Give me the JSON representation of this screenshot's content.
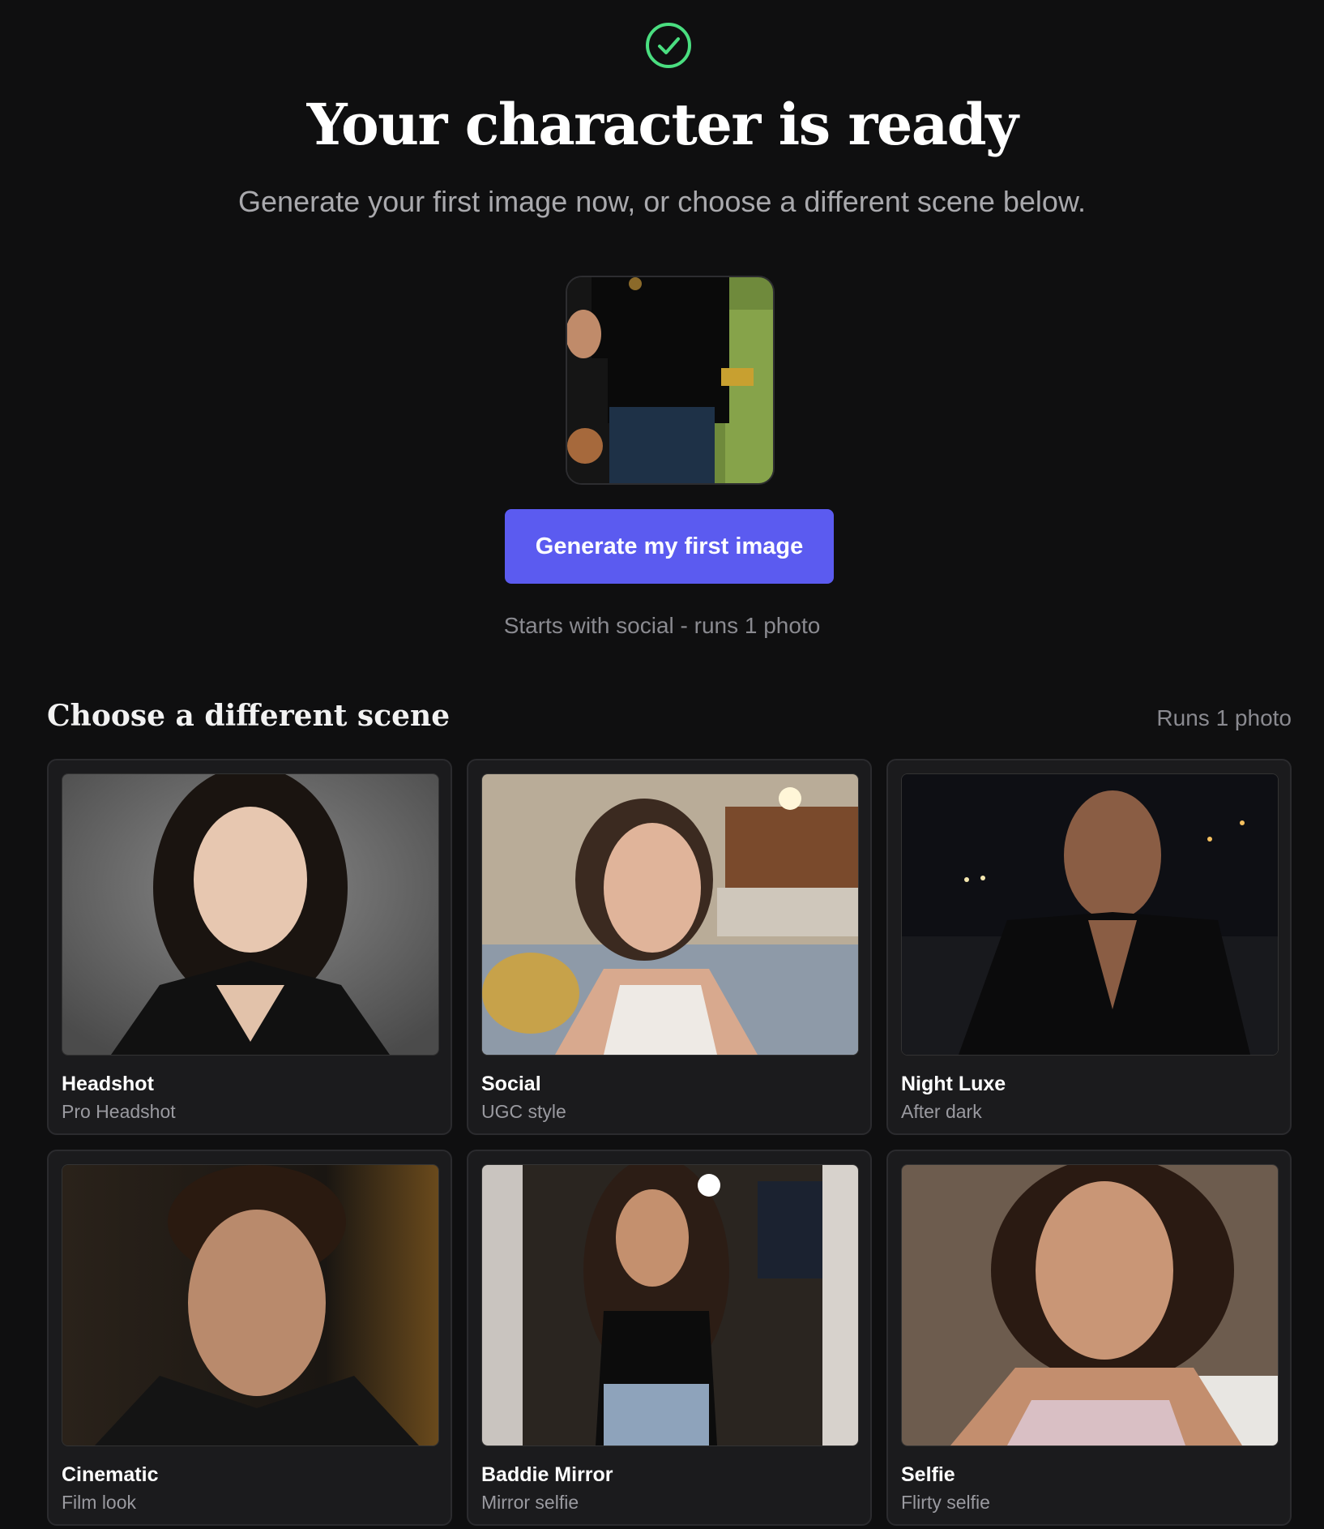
{
  "header": {
    "icon": "check-circle-icon",
    "title": "Your character is ready",
    "subtitle": "Generate your first image now, or choose a different scene below."
  },
  "preview": {
    "alt_icon": "character-preview-image"
  },
  "cta": {
    "button_label": "Generate my first image",
    "hint": "Starts with social - runs 1 photo"
  },
  "scenes": {
    "title": "Choose a different scene",
    "note": "Runs 1 photo",
    "items": [
      {
        "name": "Headshot",
        "desc": "Pro Headshot"
      },
      {
        "name": "Social",
        "desc": "UGC style"
      },
      {
        "name": "Night Luxe",
        "desc": "After dark"
      },
      {
        "name": "Cinematic",
        "desc": "Film look"
      },
      {
        "name": "Baddie Mirror",
        "desc": "Mirror selfie"
      },
      {
        "name": "Selfie",
        "desc": "Flirty selfie"
      }
    ]
  },
  "colors": {
    "background": "#0f0f10",
    "accent": "#5b5bf0",
    "success": "#4ade80"
  }
}
